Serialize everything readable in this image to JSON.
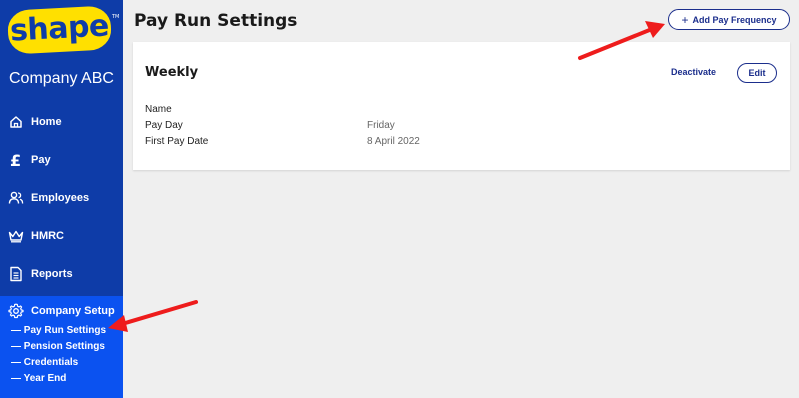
{
  "sidebar": {
    "logo_text": "shape",
    "logo_tm": "TM",
    "company_name": "Company ABC",
    "items": [
      {
        "label": "Home",
        "icon": "home-icon"
      },
      {
        "label": "Pay",
        "icon": "pound-icon"
      },
      {
        "label": "Employees",
        "icon": "users-icon"
      },
      {
        "label": "HMRC",
        "icon": "crown-icon"
      },
      {
        "label": "Reports",
        "icon": "document-icon"
      }
    ],
    "setup": {
      "label": "Company Setup",
      "icon": "gear-icon",
      "sub_items": [
        "— Pay Run Settings",
        "— Pension Settings",
        "— Credentials",
        "— Year End"
      ]
    }
  },
  "header": {
    "title": "Pay Run Settings",
    "add_button_label": "Add Pay Frequency",
    "add_button_icon": "plus-icon"
  },
  "card": {
    "title": "Weekly",
    "deactivate_label": "Deactivate",
    "edit_label": "Edit",
    "details": [
      {
        "label": "Name",
        "value": ""
      },
      {
        "label": "Pay Day",
        "value": "Friday"
      },
      {
        "label": "First Pay Date",
        "value": "8 April 2022"
      }
    ]
  },
  "colors": {
    "sidebar_bg": "#0e3ca8",
    "setup_bg": "#0b52f0",
    "logo_yellow": "#ffe000",
    "accent": "#1b2e8c",
    "annotation_red": "#ee1c1c",
    "page_bg": "#efefef"
  }
}
